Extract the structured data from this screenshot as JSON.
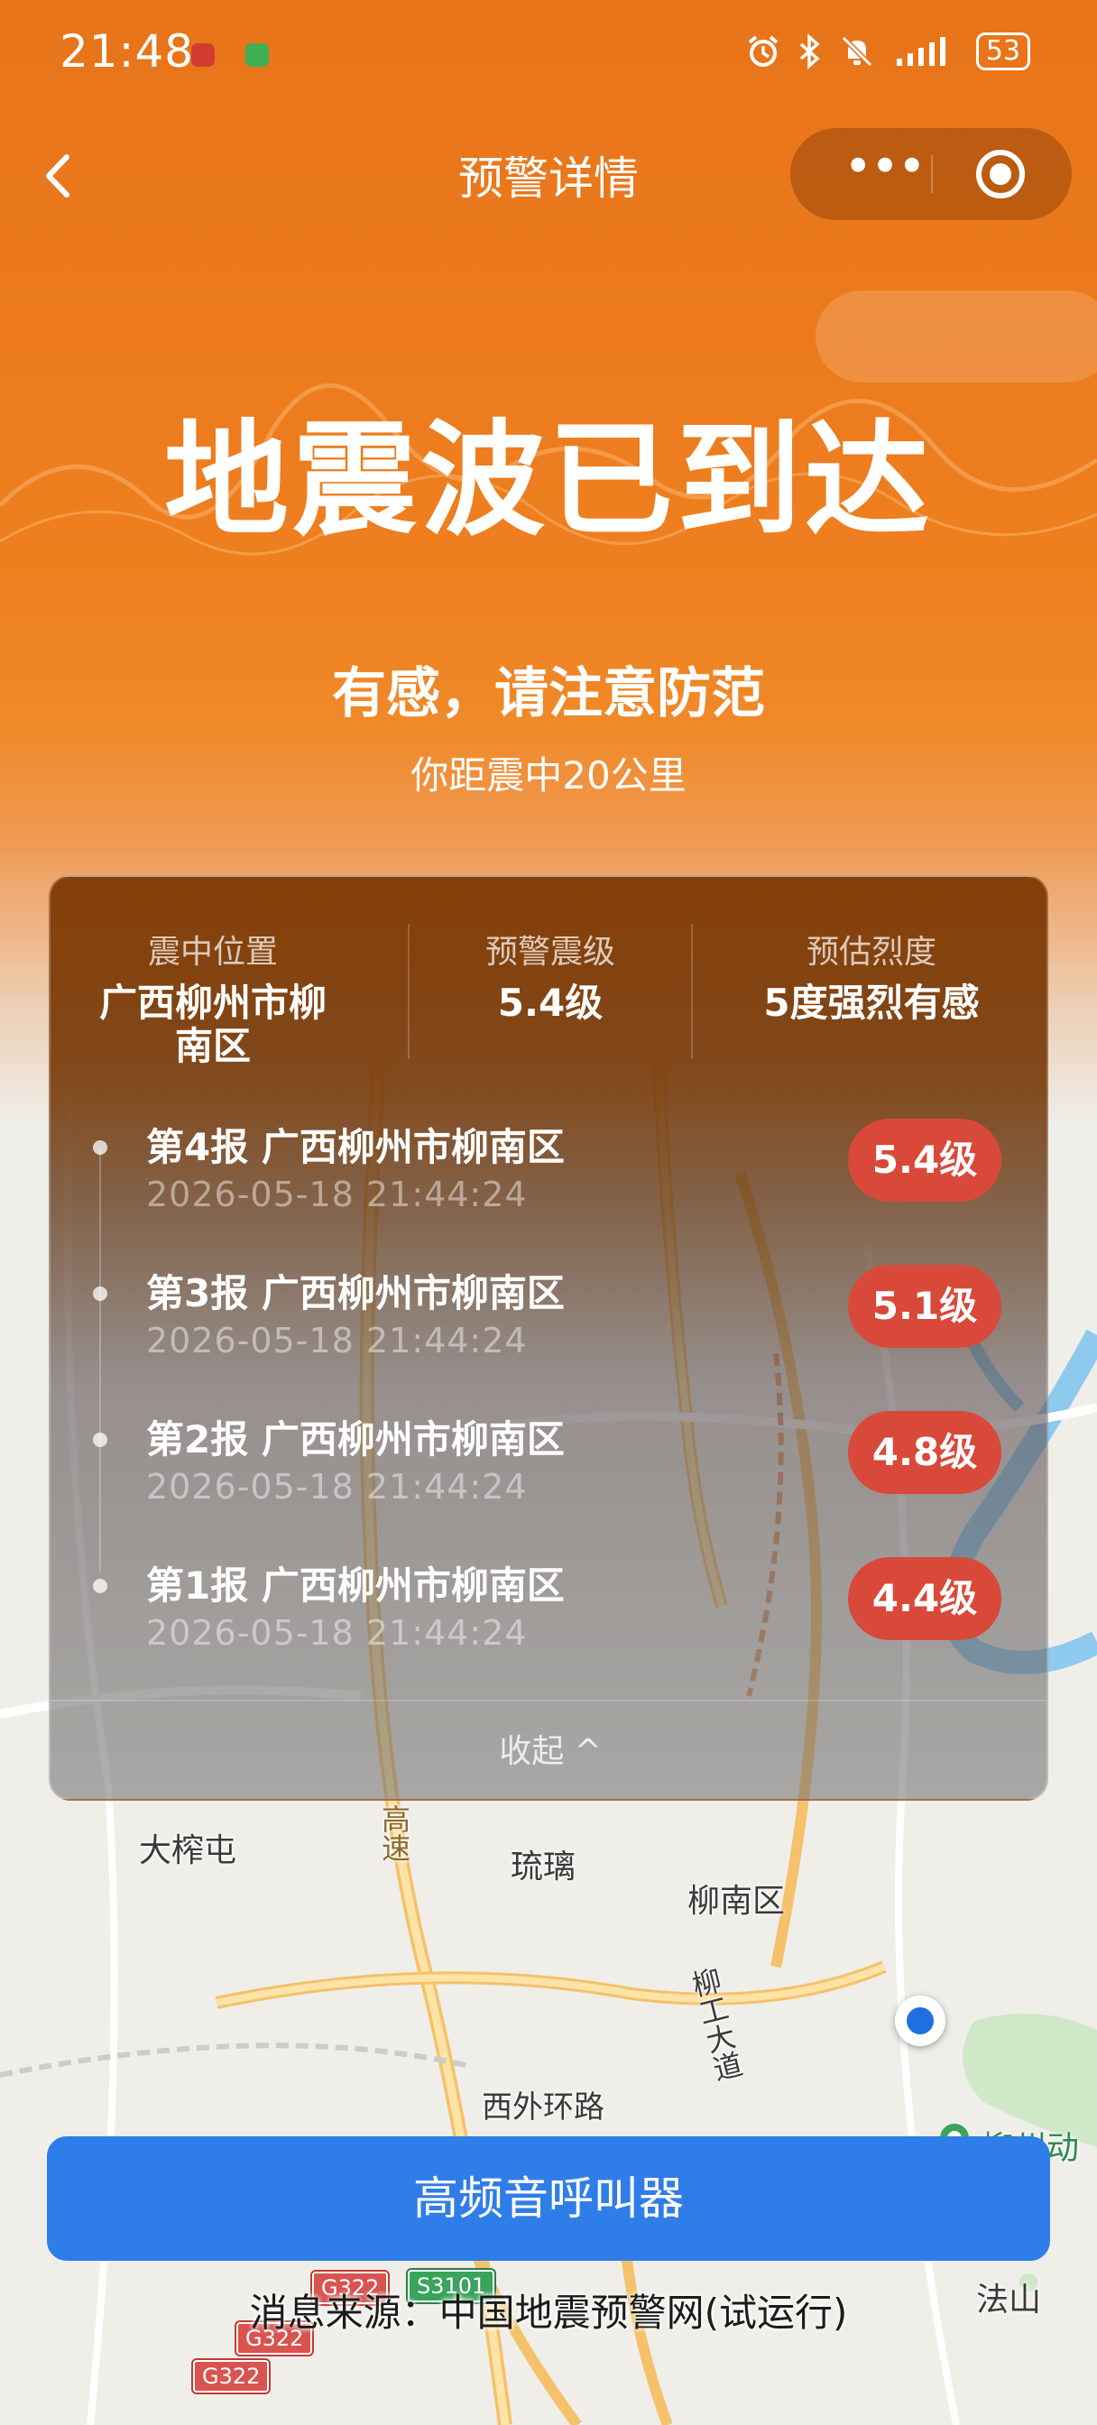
{
  "status_bar": {
    "time": "21:48",
    "battery": "53",
    "icons": [
      "alarm-icon",
      "bluetooth-icon",
      "mute-icon",
      "signal-icon",
      "battery-icon"
    ]
  },
  "nav": {
    "title": "预警详情",
    "more_label": "•••"
  },
  "alert": {
    "headline": "地震波已到达",
    "subhead": "有感，请注意防范",
    "distance": "你距震中20公里"
  },
  "summary": {
    "epicenter_label": "震中位置",
    "epicenter_value": "广西柳州市柳南区",
    "magnitude_label": "预警震级",
    "magnitude_value": "5.4级",
    "intensity_label": "预估烈度",
    "intensity_value": "5度强烈有感"
  },
  "reports": [
    {
      "title": "第4报 广西柳州市柳南区",
      "time": "2026-05-18 21:44:24",
      "magnitude": "5.4级"
    },
    {
      "title": "第3报 广西柳州市柳南区",
      "time": "2026-05-18 21:44:24",
      "magnitude": "5.1级"
    },
    {
      "title": "第2报 广西柳州市柳南区",
      "time": "2026-05-18 21:44:24",
      "magnitude": "4.8级"
    },
    {
      "title": "第1报 广西柳州市柳南区",
      "time": "2026-05-18 21:44:24",
      "magnitude": "4.4级"
    }
  ],
  "collapse_label": "收起 ^",
  "map": {
    "labels": {
      "dazhatun": "大榨屯",
      "gaosu": "高速",
      "liuli": "琉璃",
      "liunanqu": "柳南区",
      "liugong": "柳工大道",
      "xiwai": "西外环路",
      "liuzhou_zoo": "柳州动物",
      "fashan": "法山"
    },
    "badges": {
      "g322_a": "G322",
      "g322_b": "G322",
      "g322_c": "G322",
      "s3101": "S3101"
    }
  },
  "pager_button": "高频音呼叫器",
  "source": "消息来源：中国地震预警网(试运行)",
  "colors": {
    "orange": "#e8741a",
    "badge_red": "#d9493a",
    "button_blue": "#2f7de8"
  }
}
